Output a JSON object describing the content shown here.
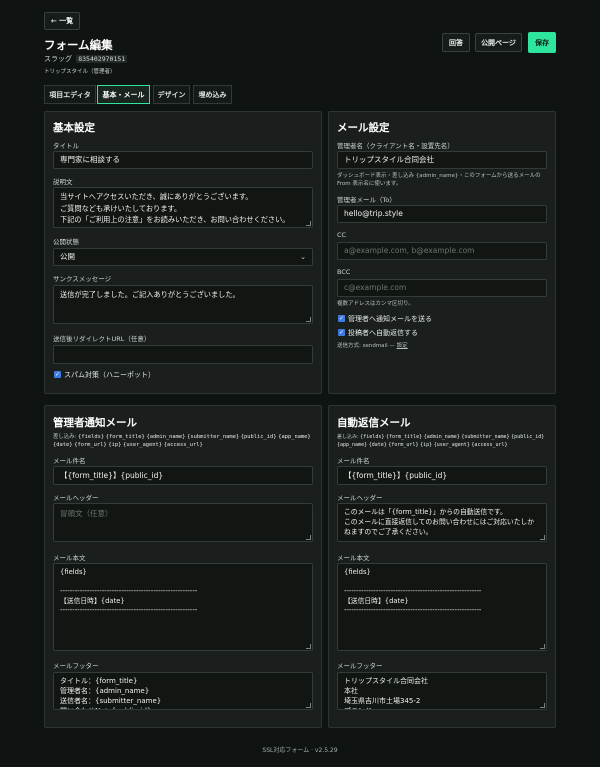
{
  "header": {
    "back_label": "← 一覧",
    "page_title": "フォーム編集",
    "slug_label": "スラッグ",
    "slug_value": "835402970151",
    "site_name": "トリップスタイル（管理者）",
    "answers_label": "回答",
    "public_page_label": "公開ページ",
    "save_label": "保存"
  },
  "tabs": [
    "項目エディタ",
    "基本・メール",
    "デザイン",
    "埋め込み"
  ],
  "basic": {
    "heading": "基本設定",
    "title_label": "タイトル",
    "title_value": "専門家に相談する",
    "desc_label": "説明文",
    "desc_value": "当サイトへアクセスいただき、誠にありがとうございます。\nご質問なども承けいたしております。\n下記の「ご利用上の注意」をお読みいただき、お問い合わせください。",
    "status_label": "公開状態",
    "status_value": "公開",
    "thanks_label": "サンクスメッセージ",
    "thanks_value": "送信が完了しました。ご記入ありがとうございました。",
    "redirect_label": "送信後リダイレクトURL（任意）",
    "redirect_value": "",
    "spam_label": "スパム対策（ハニーポット）"
  },
  "mail": {
    "heading": "メール設定",
    "admin_name_label": "管理者名（クライアント名・設置先名）",
    "admin_name_value": "トリップスタイル合同会社",
    "admin_name_help": "ダッシュボード表示・差し込み {admin_name}・このフォームから送るメールの From 表示名に使います。",
    "admin_mail_label": "管理者メール（To）",
    "admin_mail_value": "hello@trip.style",
    "cc_label": "CC",
    "cc_placeholder": "a@example.com, b@example.com",
    "bcc_label": "BCC",
    "bcc_placeholder": "c@example.com",
    "multi_help": "複数アドレスはカンマ区切り。",
    "notify_admin_label": "管理者へ通知メールを送る",
    "auto_reply_label": "投稿者へ自動返信する",
    "send_method_label": "送信方式: sendmail —",
    "send_method_link": "設定"
  },
  "admin_mail": {
    "heading": "管理者通知メール",
    "placeholders_label": "差し込み:",
    "placeholders": [
      "{fields}",
      "{form_title}",
      "{admin_name}",
      "{submitter_name}",
      "{public_id}",
      "{app_name}",
      "{date}",
      "{form_url}",
      "{ip}",
      "{user_agent}",
      "{access_url}"
    ],
    "subject_label": "メール件名",
    "subject_value": "【{form_title}】{public_id}",
    "header_label": "メールヘッダー",
    "header_placeholder": "冒頭文（任意）",
    "body_label": "メール本文",
    "body_value": "{fields}\n\n--------------------------------------------------------\n【送信日時】{date}\n--------------------------------------------------------",
    "footer_label": "メールフッター",
    "footer_value": "タイトル：{form_title}\n管理者名：{admin_name}\n送信者名：{submitter_name}\n問い合わせNo：{public_id}"
  },
  "auto_mail": {
    "heading": "自動返信メール",
    "placeholders_label": "差し込み:",
    "placeholders": [
      "{fields}",
      "{form_title}",
      "{admin_name}",
      "{submitter_name}",
      "{public_id}",
      "{app_name}",
      "{date}",
      "{form_url}",
      "{ip}",
      "{user_agent}",
      "{access_url}"
    ],
    "subject_label": "メール件名",
    "subject_value": "【{form_title}】{public_id}",
    "header_label": "メールヘッダー",
    "header_value": "このメールは「{form_title}」からの自動送信です。\nこのメールに直接返信してのお問い合わせにはご対応いたしかねますのでご了承ください。",
    "body_label": "メール本文",
    "body_value": "{fields}\n\n--------------------------------------------------------\n【送信日時】{date}\n--------------------------------------------------------",
    "footer_label": "メールフッター",
    "footer_value": "トリップスタイル合同会社\n本社\n埼玉県吉川市土場345-2\nブランド"
  },
  "footer": {
    "text": "SSL対応フォーム · v2.5.29"
  },
  "colors": {
    "accent": "#2ee59d",
    "background": "#0f1412",
    "panel": "#1a1f1d",
    "checkbox": "#3f7ae0"
  }
}
